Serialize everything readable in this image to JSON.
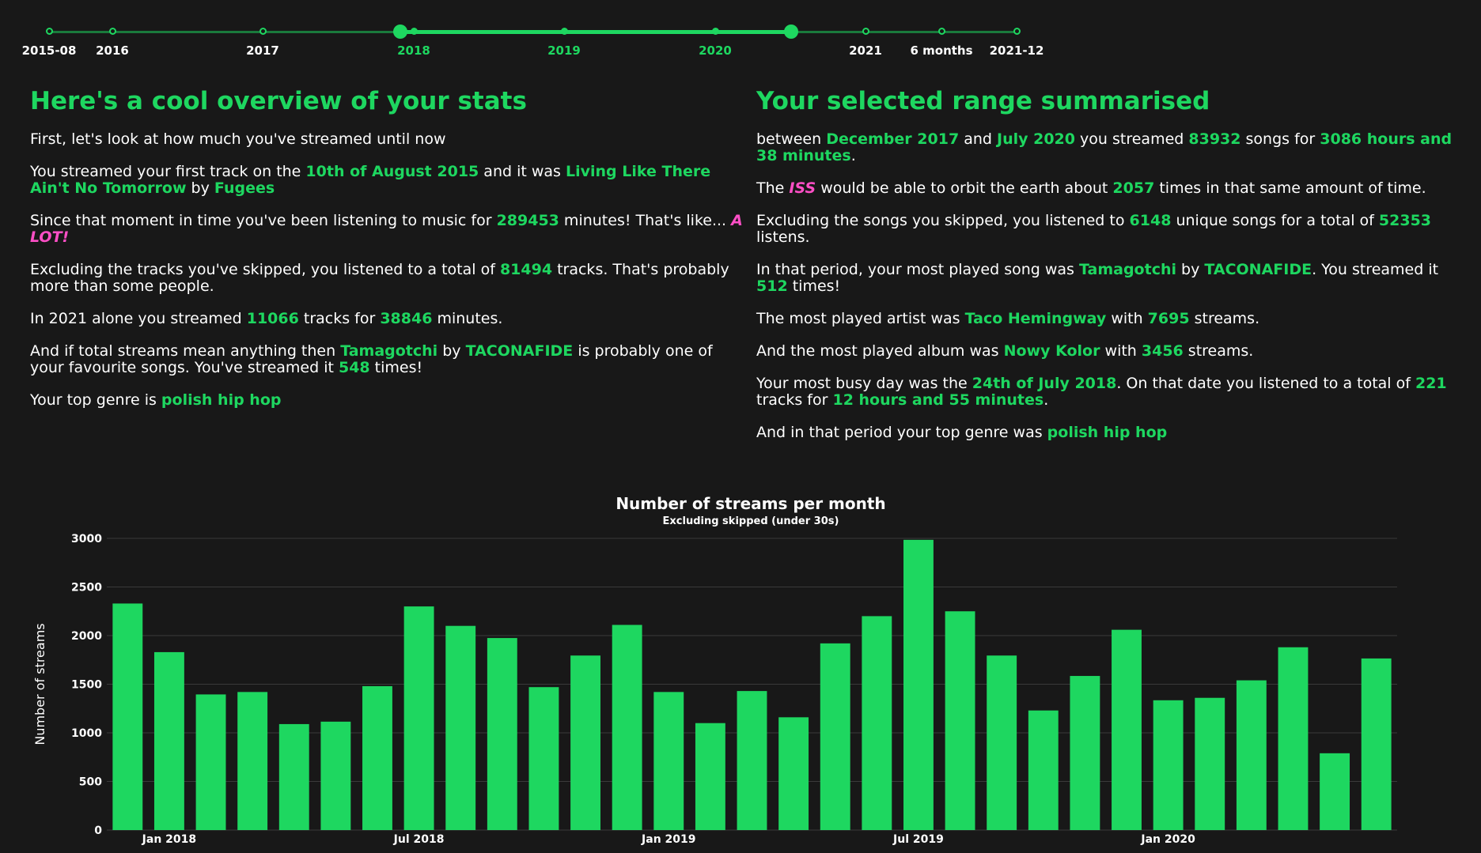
{
  "timeline": {
    "ticks": [
      {
        "label": "2015-08",
        "active": false
      },
      {
        "label": "2016",
        "active": false
      },
      {
        "label": "2017",
        "active": false
      },
      {
        "label": "2018",
        "active": true
      },
      {
        "label": "2019",
        "active": true
      },
      {
        "label": "2020",
        "active": true
      },
      {
        "label": "2021",
        "active": false
      },
      {
        "label": "6 months",
        "active": false
      },
      {
        "label": "2021-12",
        "active": false
      }
    ]
  },
  "left": {
    "heading": "Here's a cool overview of your stats",
    "p1": "First, let's look at how much you've streamed until now",
    "p2_a": "You streamed your first track on the ",
    "p2_date": "10th of August 2015",
    "p2_b": " and it was ",
    "p2_track": "Living Like There Ain't No Tomorrow",
    "p2_c": " by ",
    "p2_artist": "Fugees",
    "p3_a": "Since that moment in time you've been listening to music for ",
    "p3_minutes": "289453",
    "p3_b": " minutes! That's like... ",
    "p3_alot": "A LOT!",
    "p4_a": "Excluding the tracks you've skipped, you listened to a total of ",
    "p4_tracks": "81494",
    "p4_b": " tracks. That's probably more than some people.",
    "p5_a": "In 2021 alone you streamed ",
    "p5_tracks": "11066",
    "p5_b": " tracks for ",
    "p5_minutes": "38846",
    "p5_c": " minutes.",
    "p6_a": "And if total streams mean anything then ",
    "p6_song": "Tamagotchi",
    "p6_b": " by ",
    "p6_artist": "TACONAFIDE",
    "p6_c": " is probably one of your favourite songs. You've streamed it ",
    "p6_count": "548",
    "p6_d": " times!",
    "p7_a": "Your top genre is ",
    "p7_genre": "polish hip hop"
  },
  "right": {
    "heading": "Your selected range summarised",
    "p1_a": "between ",
    "p1_start": "December 2017",
    "p1_b": " and ",
    "p1_end": "July 2020",
    "p1_c": " you streamed ",
    "p1_songs": "83932",
    "p1_d": " songs for ",
    "p1_hours": "3086 hours and 38 minutes",
    "p1_e": ".",
    "p2_a": "The ",
    "p2_iss": "ISS",
    "p2_b": " would be able to orbit the earth about ",
    "p2_times": "2057",
    "p2_c": " times in that same amount of time.",
    "p3_a": "Excluding the songs you skipped, you listened to ",
    "p3_unique": "6148",
    "p3_b": " unique songs for a total of ",
    "p3_listens": "52353",
    "p3_c": " listens.",
    "p4_a": "In that period, your most played song was ",
    "p4_song": "Tamagotchi",
    "p4_b": " by ",
    "p4_artist": "TACONAFIDE",
    "p4_c": ". You streamed it ",
    "p4_count": "512",
    "p4_d": " times!",
    "p5_a": "The most played artist was ",
    "p5_artist": "Taco Hemingway",
    "p5_b": " with ",
    "p5_streams": "7695",
    "p5_c": " streams.",
    "p6_a": "And the most played album was ",
    "p6_album": "Nowy Kolor",
    "p6_b": " with ",
    "p6_streams": "3456",
    "p6_c": " streams.",
    "p7_a": "Your most busy day was the ",
    "p7_date": "24th of July 2018",
    "p7_b": ". On that date you listened to a total of ",
    "p7_tracks": "221",
    "p7_c": " tracks for ",
    "p7_time": "12 hours and 55 minutes",
    "p7_d": ".",
    "p8_a": "And in that period your top genre was ",
    "p8_genre": "polish hip hop"
  },
  "colors": {
    "accent": "#1ed760",
    "highlight": "#ff4fc6",
    "background": "#181818"
  },
  "chart_data": {
    "type": "bar",
    "title": "Number of streams per month",
    "subtitle": "Excluding skipped (under 30s)",
    "xlabel": "",
    "ylabel": "Number of streams",
    "ylim": [
      0,
      3000
    ],
    "yticks": [
      0,
      500,
      1000,
      1500,
      2000,
      2500,
      3000
    ],
    "xtick_labels": [
      {
        "label": "Jan 2018",
        "index": 1
      },
      {
        "label": "Jul 2018",
        "index": 7
      },
      {
        "label": "Jan 2019",
        "index": 13
      },
      {
        "label": "Jul 2019",
        "index": 19
      },
      {
        "label": "Jan 2020",
        "index": 25
      }
    ],
    "categories": [
      "2017-12",
      "2018-01",
      "2018-02",
      "2018-03",
      "2018-04",
      "2018-05",
      "2018-06",
      "2018-07",
      "2018-08",
      "2018-09",
      "2018-10",
      "2018-11",
      "2018-12",
      "2019-01",
      "2019-02",
      "2019-03",
      "2019-04",
      "2019-05",
      "2019-06",
      "2019-07",
      "2019-08",
      "2019-09",
      "2019-10",
      "2019-11",
      "2019-12",
      "2020-01",
      "2020-02",
      "2020-03",
      "2020-04",
      "2020-05",
      "2020-06",
      "2020-07"
    ],
    "values": [
      2330,
      1830,
      1395,
      1420,
      1090,
      1115,
      1480,
      2300,
      2100,
      1975,
      1470,
      1795,
      2110,
      1420,
      1100,
      1430,
      1160,
      1920,
      2200,
      2985,
      2250,
      1795,
      1230,
      1585,
      2060,
      1335,
      1360,
      1540,
      1880,
      790,
      1765
    ],
    "bar_color": "#1ed760",
    "grid": true
  }
}
